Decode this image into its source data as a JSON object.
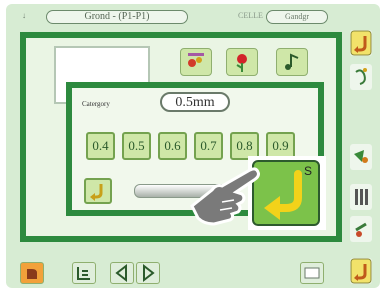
{
  "header": {
    "corner_label": "↓",
    "title": "Grond - (P1-P1)",
    "right_label": "CELLE",
    "right_pill": "Gandgr"
  },
  "dialog": {
    "category_label": "Catergory",
    "value": "0.5mm",
    "options": [
      "0.4",
      "0.5",
      "0.6",
      "0.7",
      "0.8",
      "0.9"
    ]
  },
  "ok_button": {
    "superscript": "S"
  },
  "colors": {
    "frame_green": "#2d8a3e",
    "button_green": "#cfe7a8",
    "ok_green": "#7cc24a",
    "background": "#d7ecd3"
  },
  "icons": {
    "toolbar": [
      "sewing-pattern-icon",
      "needle-plant-icon",
      "music-note-icon"
    ],
    "right_column": [
      "return-icon",
      "wave-icon",
      "arrow-icon",
      "tool-icon",
      "bars-icon",
      "clip-icon",
      "return-icon"
    ],
    "bottom": [
      "home-icon",
      "grid-icon",
      "prev-icon",
      "next-icon",
      "list-icon"
    ],
    "pointer": "pointing-hand-icon"
  }
}
